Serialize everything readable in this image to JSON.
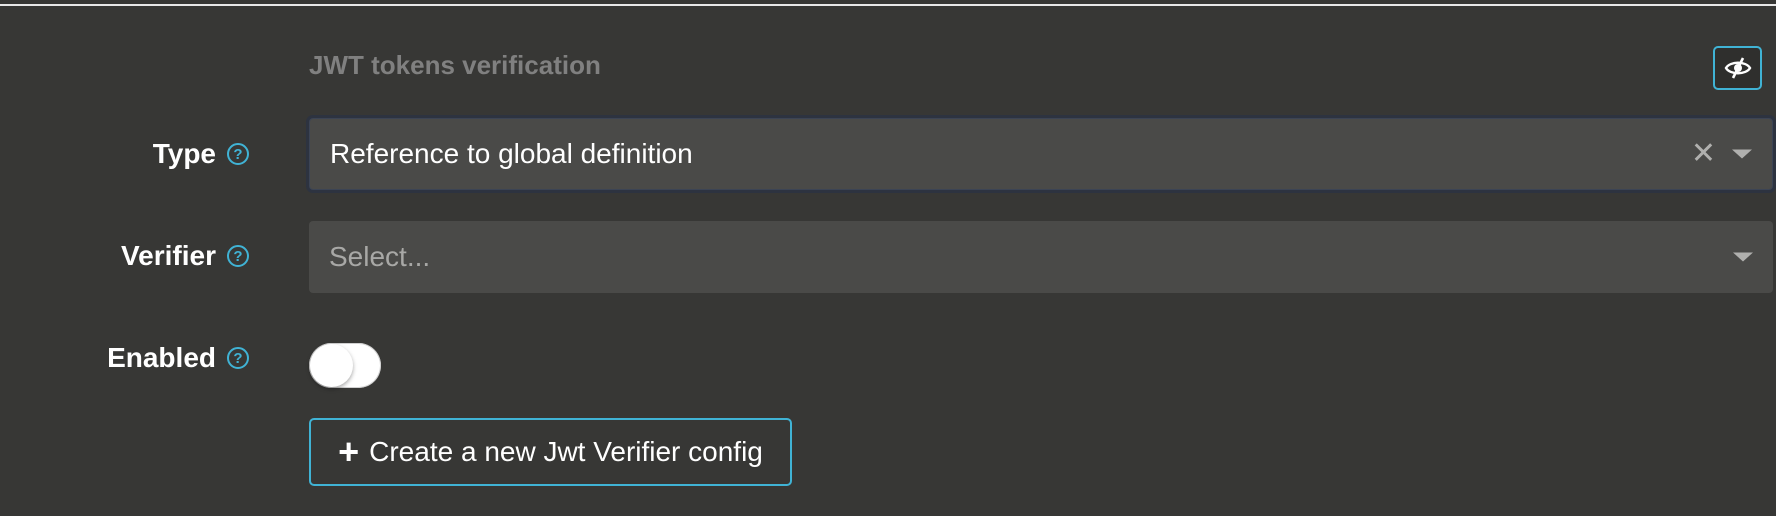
{
  "section": {
    "title": "JWT tokens verification"
  },
  "toolbar": {
    "visibility_icon": "eye-slash-icon"
  },
  "fields": {
    "type": {
      "label": "Type",
      "help": "?",
      "value": "Reference to global definition",
      "clear": "✕"
    },
    "verifier": {
      "label": "Verifier",
      "help": "?",
      "placeholder": "Select..."
    },
    "enabled": {
      "label": "Enabled",
      "help": "?",
      "state": "off"
    }
  },
  "actions": {
    "create_icon": "+",
    "create_label": "Create a new Jwt Verifier config"
  },
  "colors": {
    "background": "#373735",
    "accent": "#40b3d5",
    "input_bg": "#4a4a48"
  }
}
